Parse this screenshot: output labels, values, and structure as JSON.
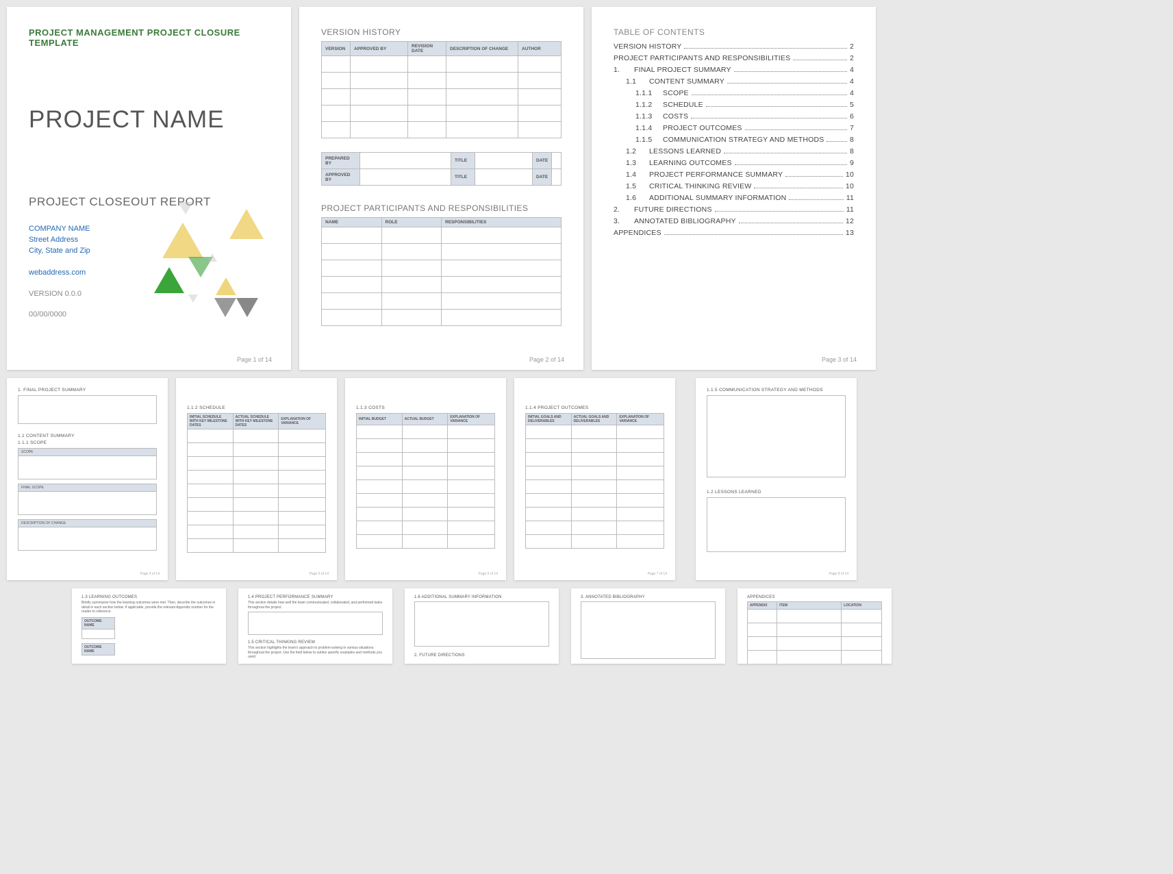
{
  "page1": {
    "header": "PROJECT MANAGEMENT PROJECT CLOSURE TEMPLATE",
    "title": "PROJECT NAME",
    "subtitle": "PROJECT CLOSEOUT REPORT",
    "company": "COMPANY NAME",
    "street": "Street Address",
    "city": "City, State and Zip",
    "web": "webaddress.com",
    "version": "VERSION 0.0.0",
    "date": "00/00/0000",
    "pgnum": "Page 1 of 14"
  },
  "page2": {
    "section1": "VERSION HISTORY",
    "vh_cols": [
      "VERSION",
      "APPROVED BY",
      "REVISION DATE",
      "DESCRIPTION OF CHANGE",
      "AUTHOR"
    ],
    "prep": "PREPARED BY",
    "appr": "APPROVED BY",
    "ttl": "TITLE",
    "dte": "DATE",
    "section2": "PROJECT PARTICIPANTS AND RESPONSIBILITIES",
    "pp_cols": [
      "NAME",
      "ROLE",
      "RESPONSIBILITIES"
    ],
    "pgnum": "Page 2 of 14"
  },
  "page3": {
    "heading": "TABLE OF CONTENTS",
    "items": [
      {
        "lvl": "top",
        "num": "",
        "label": "VERSION HISTORY",
        "pg": "2"
      },
      {
        "lvl": "top",
        "num": "",
        "label": "PROJECT PARTICIPANTS AND RESPONSIBILITIES",
        "pg": "2"
      },
      {
        "lvl": "l1",
        "num": "1.",
        "label": "FINAL PROJECT SUMMARY",
        "pg": "4"
      },
      {
        "lvl": "l2",
        "num": "1.1",
        "label": "CONTENT SUMMARY",
        "pg": "4"
      },
      {
        "lvl": "l3",
        "num": "1.1.1",
        "label": "SCOPE",
        "pg": "4"
      },
      {
        "lvl": "l3",
        "num": "1.1.2",
        "label": "SCHEDULE",
        "pg": "5"
      },
      {
        "lvl": "l3",
        "num": "1.1.3",
        "label": "COSTS",
        "pg": "6"
      },
      {
        "lvl": "l3",
        "num": "1.1.4",
        "label": "PROJECT OUTCOMES",
        "pg": "7"
      },
      {
        "lvl": "l3",
        "num": "1.1.5",
        "label": "COMMUNICATION STRATEGY AND METHODS",
        "pg": "8"
      },
      {
        "lvl": "l2",
        "num": "1.2",
        "label": "LESSONS LEARNED",
        "pg": "8"
      },
      {
        "lvl": "l2",
        "num": "1.3",
        "label": "LEARNING OUTCOMES",
        "pg": "9"
      },
      {
        "lvl": "l2",
        "num": "1.4",
        "label": "PROJECT PERFORMANCE SUMMARY",
        "pg": "10"
      },
      {
        "lvl": "l2",
        "num": "1.5",
        "label": "CRITICAL THINKING REVIEW",
        "pg": "10"
      },
      {
        "lvl": "l2",
        "num": "1.6",
        "label": "ADDITIONAL SUMMARY INFORMATION",
        "pg": "11"
      },
      {
        "lvl": "l1",
        "num": "2.",
        "label": "FUTURE DIRECTIONS",
        "pg": "11"
      },
      {
        "lvl": "l1",
        "num": "3.",
        "label": "ANNOTATED BIBLIOGRAPHY",
        "pg": "12"
      },
      {
        "lvl": "top",
        "num": "",
        "label": "APPENDICES",
        "pg": "13"
      }
    ],
    "pgnum": "Page 3 of 14"
  },
  "row2": {
    "p4": {
      "h1": "1. FINAL PROJECT SUMMARY",
      "h2": "1.1 CONTENT SUMMARY",
      "h3": "1.1.1 SCOPE",
      "scope": "SCOPE",
      "final": "FINAL SCOPE",
      "desc": "DESCRIPTION OF CHANGE",
      "pg": "Page 4 of 14"
    },
    "p5": {
      "h": "1.1.2 SCHEDULE",
      "cols": [
        "INITIAL SCHEDULE with Key Milestone Dates",
        "ACTUAL SCHEDULE with Key Milestone Dates",
        "EXPLANATION OF VARIANCE"
      ],
      "pg": "Page 5 of 14"
    },
    "p6": {
      "h": "1.1.3 COSTS",
      "cols": [
        "INITIAL BUDGET",
        "ACTUAL BUDGET",
        "EXPLANATION OF VARIANCE"
      ],
      "pg": "Page 6 of 14"
    },
    "p7": {
      "h": "1.1.4 PROJECT OUTCOMES",
      "cols": [
        "INITIAL GOALS AND DELIVERABLES",
        "ACTUAL GOALS AND DELIVERABLES",
        "EXPLANATION OF VARIANCE"
      ],
      "pg": "Page 7 of 14"
    },
    "p8": {
      "h1": "1.1.5 COMMUNICATION STRATEGY AND METHODS",
      "h2": "1.2 LESSONS LEARNED",
      "pg": "Page 8 of 14"
    }
  },
  "row3": {
    "p9": {
      "h": "1.3 LEARNING OUTCOMES",
      "txt": "Briefly summarize how the learning outcomes were met. Then, describe the outcomes in detail in each section below. If applicable, provide the relevant Appendix number for the reader to reference.",
      "col": "OUTCOME NAME"
    },
    "p10": {
      "h1": "1.4 PROJECT PERFORMANCE SUMMARY",
      "t1": "This section details how well the team communicated, collaborated, and performed tasks throughout the project.",
      "h2": "1.5 CRITICAL THINKING REVIEW",
      "t2": "This section highlights the team's approach to problem-solving in various situations throughout the project. Use the field below to outline specific examples and methods you used."
    },
    "p11": {
      "h1": "1.6 ADDITIONAL SUMMARY INFORMATION",
      "h2": "2. FUTURE DIRECTIONS"
    },
    "p12": {
      "h": "3. ANNOTATED BIBLIOGRAPHY"
    },
    "p13": {
      "h": "APPENDICES",
      "cols": [
        "APPENDIX",
        "ITEM",
        "LOCATION"
      ]
    }
  }
}
